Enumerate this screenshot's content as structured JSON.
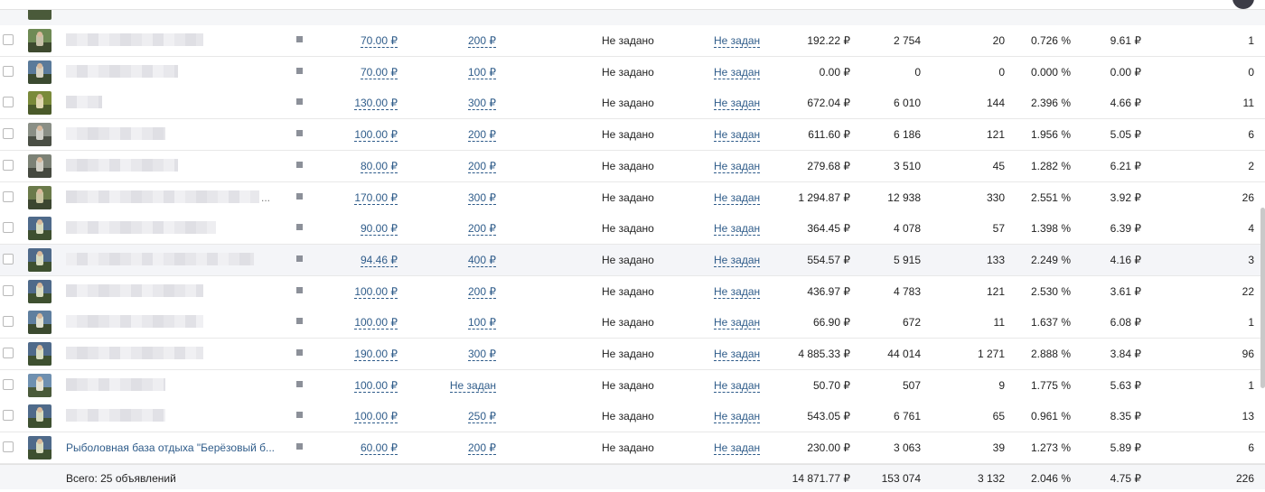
{
  "table": {
    "rows": [
      {
        "name": "",
        "price": "70.00 ₽",
        "budget": "200 ₽",
        "goal": "Не задано",
        "target": "Не задан",
        "spent": "192.22 ₽",
        "views": "2 754",
        "clicks": "20",
        "ctr": "0.726 %",
        "cpc": "9.61 ₽",
        "last": "1"
      },
      {
        "name": "",
        "price": "70.00 ₽",
        "budget": "100 ₽",
        "goal": "Не задано",
        "target": "Не задан",
        "spent": "0.00 ₽",
        "views": "0",
        "clicks": "0",
        "ctr": "0.000 %",
        "cpc": "0.00 ₽",
        "last": "0"
      },
      {
        "name": "",
        "price": "130.00 ₽",
        "budget": "300 ₽",
        "goal": "Не задано",
        "target": "Не задан",
        "spent": "672.04 ₽",
        "views": "6 010",
        "clicks": "144",
        "ctr": "2.396 %",
        "cpc": "4.66 ₽",
        "last": "11"
      },
      {
        "name": "",
        "price": "100.00 ₽",
        "budget": "200 ₽",
        "goal": "Не задано",
        "target": "Не задан",
        "spent": "611.60 ₽",
        "views": "6 186",
        "clicks": "121",
        "ctr": "1.956 %",
        "cpc": "5.05 ₽",
        "last": "6"
      },
      {
        "name": "",
        "price": "80.00 ₽",
        "budget": "200 ₽",
        "goal": "Не задано",
        "target": "Не задан",
        "spent": "279.68 ₽",
        "views": "3 510",
        "clicks": "45",
        "ctr": "1.282 %",
        "cpc": "6.21 ₽",
        "last": "2"
      },
      {
        "name": "...",
        "price": "170.00 ₽",
        "budget": "300 ₽",
        "goal": "Не задано",
        "target": "Не задан",
        "spent": "1 294.87 ₽",
        "views": "12 938",
        "clicks": "330",
        "ctr": "2.551 %",
        "cpc": "3.92 ₽",
        "last": "26"
      },
      {
        "name": "",
        "price": "90.00 ₽",
        "budget": "200 ₽",
        "goal": "Не задано",
        "target": "Не задан",
        "spent": "364.45 ₽",
        "views": "4 078",
        "clicks": "57",
        "ctr": "1.398 %",
        "cpc": "6.39 ₽",
        "last": "4"
      },
      {
        "name": "",
        "price": "94.46 ₽",
        "budget": "400 ₽",
        "goal": "Не задано",
        "target": "Не задан",
        "spent": "554.57 ₽",
        "views": "5 915",
        "clicks": "133",
        "ctr": "2.249 %",
        "cpc": "4.16 ₽",
        "last": "3"
      },
      {
        "name": "",
        "price": "100.00 ₽",
        "budget": "200 ₽",
        "goal": "Не задано",
        "target": "Не задан",
        "spent": "436.97 ₽",
        "views": "4 783",
        "clicks": "121",
        "ctr": "2.530 %",
        "cpc": "3.61 ₽",
        "last": "22"
      },
      {
        "name": "",
        "price": "100.00 ₽",
        "budget": "100 ₽",
        "goal": "Не задано",
        "target": "Не задан",
        "spent": "66.90 ₽",
        "views": "672",
        "clicks": "11",
        "ctr": "1.637 %",
        "cpc": "6.08 ₽",
        "last": "1"
      },
      {
        "name": "",
        "price": "190.00 ₽",
        "budget": "300 ₽",
        "goal": "Не задано",
        "target": "Не задан",
        "spent": "4 885.33 ₽",
        "views": "44 014",
        "clicks": "1 271",
        "ctr": "2.888 %",
        "cpc": "3.84 ₽",
        "last": "96"
      },
      {
        "name": "",
        "price": "100.00 ₽",
        "budget": "Не задан",
        "goal": "Не задано",
        "target": "Не задан",
        "spent": "50.70 ₽",
        "views": "507",
        "clicks": "9",
        "ctr": "1.775 %",
        "cpc": "5.63 ₽",
        "last": "1"
      },
      {
        "name": "",
        "price": "100.00 ₽",
        "budget": "250 ₽",
        "goal": "Не задано",
        "target": "Не задан",
        "spent": "543.05 ₽",
        "views": "6 761",
        "clicks": "65",
        "ctr": "0.961 %",
        "cpc": "8.35 ₽",
        "last": "13"
      },
      {
        "name": "Рыболовная база отдыха \"Берёзовый б...",
        "price": "60.00 ₽",
        "budget": "200 ₽",
        "goal": "Не задано",
        "target": "Не задан",
        "spent": "230.00 ₽",
        "views": "3 063",
        "clicks": "39",
        "ctr": "1.273 %",
        "cpc": "5.89 ₽",
        "last": "6"
      }
    ]
  },
  "footer": {
    "total_label": "Всего: 25 объявлений",
    "spent": "14 871.77 ₽",
    "views": "153 074",
    "clicks": "3 132",
    "ctr": "2.046 %",
    "cpc": "4.75 ₽",
    "last": "226"
  },
  "colors": {
    "link": "#2f5c8a",
    "row_highlight": "#f4f5f8",
    "status_square": "#8c9099"
  }
}
